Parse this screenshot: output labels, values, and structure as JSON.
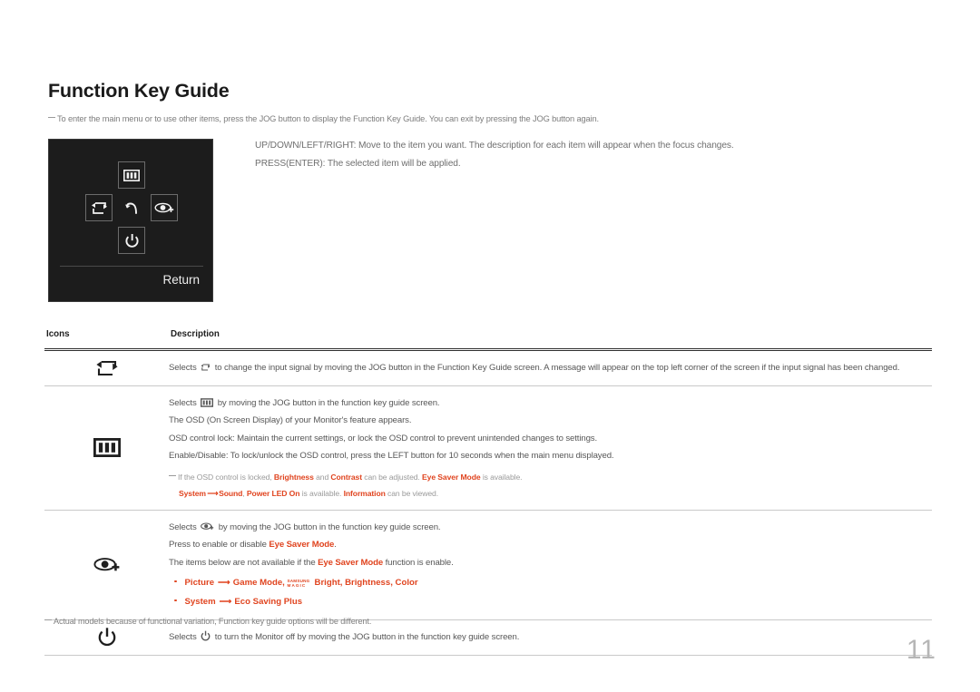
{
  "page": {
    "title": "Function Key Guide",
    "intro_note": "To enter the main menu or to use other items, press the JOG button to display the Function Key Guide. You can exit by pressing the JOG button again.",
    "footer_note": "Actual models because of functional variation, Function key guide options will be different.",
    "page_number": "11"
  },
  "osd_panel": {
    "return_label": "Return",
    "keys": [
      {
        "name": "menu-icon",
        "position": "top"
      },
      {
        "name": "source-icon",
        "position": "left"
      },
      {
        "name": "back-icon",
        "position": "center"
      },
      {
        "name": "eye-saver-icon",
        "position": "right"
      },
      {
        "name": "power-icon",
        "position": "bottom"
      }
    ]
  },
  "instructions": {
    "line1": "UP/DOWN/LEFT/RIGHT: Move to the item you want. The description for each item will appear when the focus changes.",
    "line2": "PRESS(ENTER): The selected item will be applied."
  },
  "table": {
    "headers": {
      "icons": "Icons",
      "description": "Description"
    },
    "rows": [
      {
        "icon": "source-icon",
        "lines": [
          {
            "pre": "Selects ",
            "inline_icon": "source-icon",
            "post": " to change the input signal by moving the JOG button in the Function Key Guide screen. A message will appear on the top left corner of the screen if the input signal has been changed."
          }
        ]
      },
      {
        "icon": "menu-icon",
        "lines": [
          {
            "pre": "Selects ",
            "inline_icon": "menu-icon",
            "post": " by moving the JOG button in the function key guide screen."
          },
          {
            "pre": "The OSD (On Screen Display) of your Monitor's feature appears.",
            "inline_icon": null,
            "post": ""
          },
          {
            "pre": "OSD control lock: Maintain the current settings, or lock the OSD control to prevent unintended changes to settings.",
            "inline_icon": null,
            "post": ""
          },
          {
            "pre": "Enable/Disable: To lock/unlock the OSD control, press the LEFT button for 10 seconds when the main menu displayed.",
            "inline_icon": null,
            "post": ""
          }
        ],
        "sub_notes": [
          {
            "segments": [
              {
                "text": "If the OSD control is locked, ",
                "red": false
              },
              {
                "text": "Brightness",
                "red": true
              },
              {
                "text": " and ",
                "red": false
              },
              {
                "text": "Contrast",
                "red": true
              },
              {
                "text": " can be adjusted. ",
                "red": false
              },
              {
                "text": "Eye Saver Mode",
                "red": true
              },
              {
                "text": " is available.",
                "red": false
              }
            ]
          },
          {
            "segments": [
              {
                "text": "System",
                "red": true
              },
              {
                "text": " ⟶ ",
                "red": true
              },
              {
                "text": "Sound",
                "red": true
              },
              {
                "text": ", ",
                "red": false
              },
              {
                "text": "Power LED On",
                "red": true
              },
              {
                "text": " is available. ",
                "red": false
              },
              {
                "text": "Information",
                "red": true
              },
              {
                "text": " can be viewed.",
                "red": false
              }
            ]
          }
        ]
      },
      {
        "icon": "eye-saver-icon",
        "lines": [
          {
            "pre": "Selects ",
            "inline_icon": "eye-saver-icon",
            "post": " by moving the JOG button in the function key guide screen."
          }
        ],
        "rich_lines": [
          {
            "segments": [
              {
                "text": "Press to enable or disable ",
                "red": false
              },
              {
                "text": "Eye Saver Mode",
                "red": true
              },
              {
                "text": ".",
                "red": false
              }
            ]
          },
          {
            "segments": [
              {
                "text": "The items below are not available if the ",
                "red": false
              },
              {
                "text": "Eye Saver Mode",
                "red": true
              },
              {
                "text": " function is enable.",
                "red": false
              }
            ]
          }
        ],
        "bullets": [
          {
            "text_before": "Picture",
            "arrow": "⟶",
            "text_mid": "Game Mode, ",
            "magic_top": "SAMSUNG",
            "magic_bot": "MAGIC",
            "text_after": "Bright, Brightness, Color"
          },
          {
            "text_before": "System",
            "arrow": "⟶",
            "text_mid": "Eco Saving Plus",
            "magic_top": "",
            "magic_bot": "",
            "text_after": ""
          }
        ]
      },
      {
        "icon": "power-icon",
        "lines": [
          {
            "pre": "Selects ",
            "inline_icon": "power-icon",
            "post": " to turn the Monitor off by moving the JOG button in the function key guide screen."
          }
        ]
      }
    ]
  },
  "colors": {
    "accent_red": "#e0441f",
    "body_text": "#575757",
    "note_text": "#9a9a9a",
    "panel_bg": "#1c1c1c",
    "page_number": "#b6b6b6"
  }
}
